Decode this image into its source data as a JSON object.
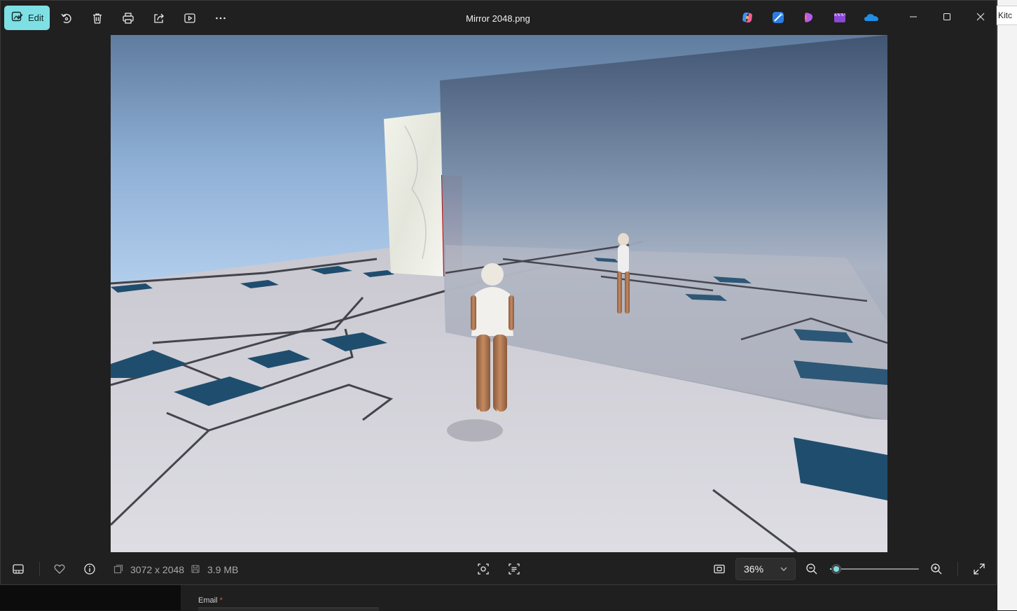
{
  "window": {
    "title": "Mirror 2048.png",
    "accent": "#7ee0e4"
  },
  "toolbar": {
    "edit_label": "Edit",
    "icons": [
      "edit-icon",
      "rotate-icon",
      "delete-icon",
      "print-icon",
      "share-icon",
      "slideshow-icon",
      "more-icon"
    ]
  },
  "apps": [
    "copilot-icon",
    "designer-icon",
    "clipchamp-icon",
    "video-editor-icon",
    "onedrive-icon"
  ],
  "image_info": {
    "dimensions": "3072 x 2048",
    "file_size": "3.9 MB"
  },
  "zoom": {
    "value": "36%",
    "slider_fraction": 0.07
  },
  "background": {
    "right_tab_label": "Kitc",
    "email_label": "Email",
    "email_required_mark": "*"
  }
}
